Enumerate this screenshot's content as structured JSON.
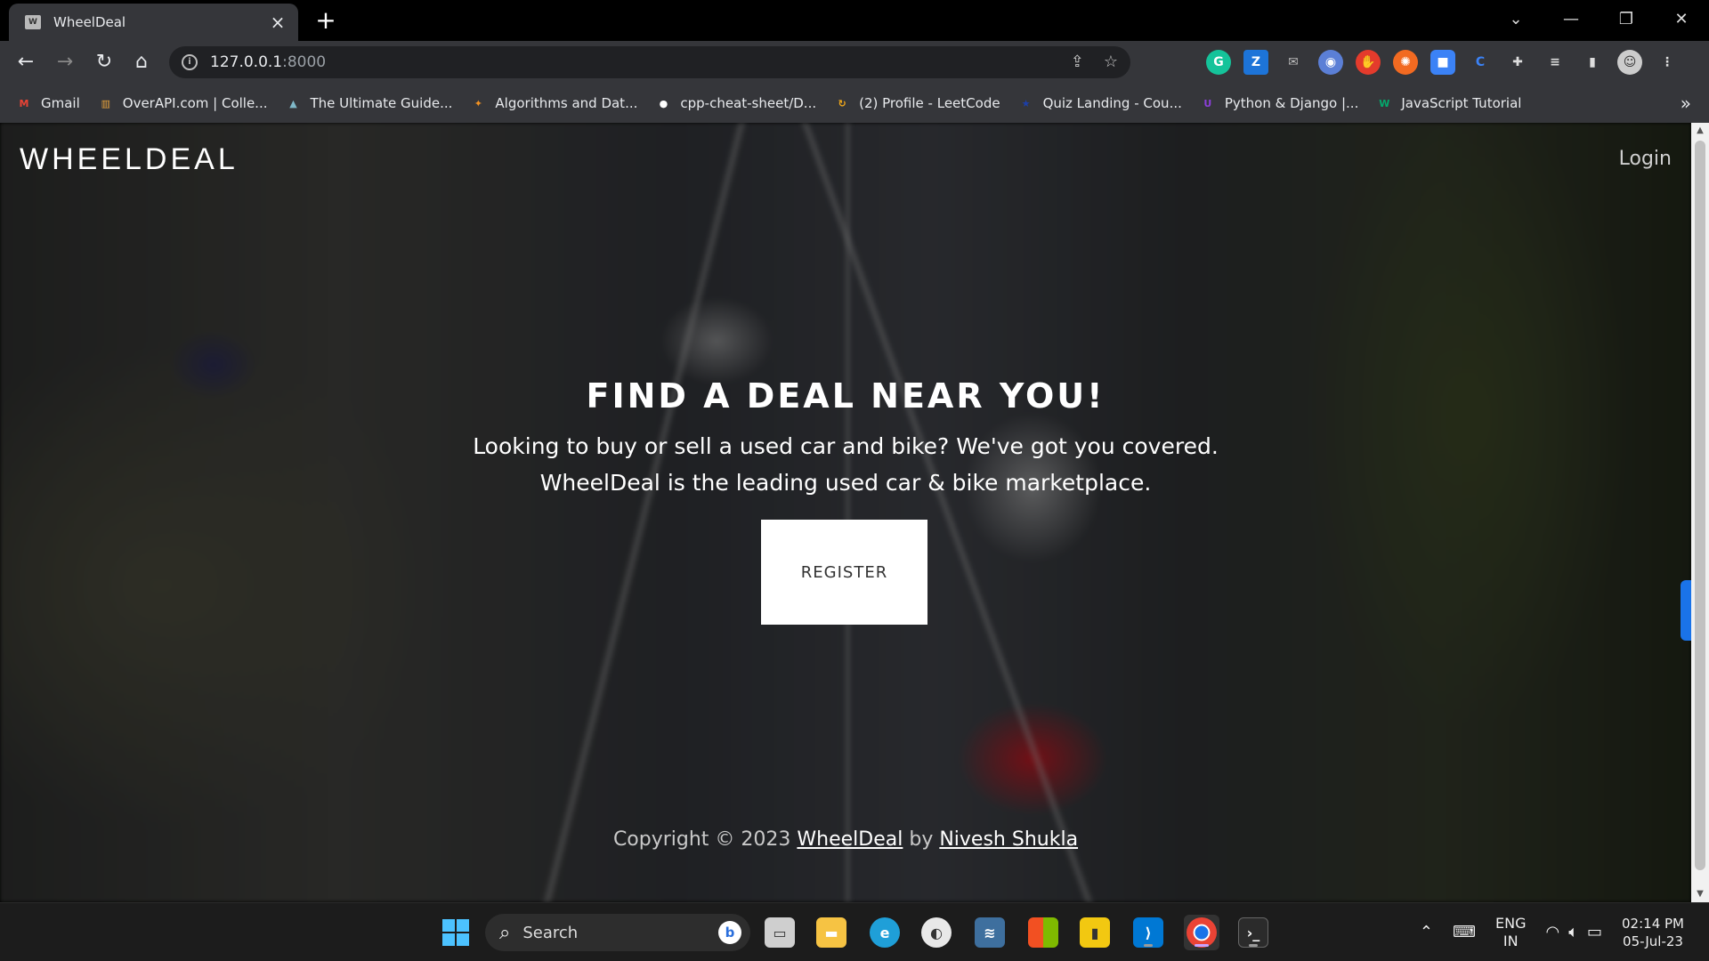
{
  "browser": {
    "tab_title": "WheelDeal",
    "url_host": "127.0.0.1",
    "url_port": ":8000",
    "bookmarks": [
      {
        "label": "Gmail",
        "color": "#ea4335",
        "glyph": "M"
      },
      {
        "label": "OverAPI.com | Colle...",
        "color": "#e8a33c",
        "glyph": "▥"
      },
      {
        "label": "The Ultimate Guide...",
        "color": "#7fb8c8",
        "glyph": "▲"
      },
      {
        "label": "Algorithms and Dat...",
        "color": "#f29222",
        "glyph": "✦"
      },
      {
        "label": "cpp-cheat-sheet/D...",
        "color": "#ffffff",
        "glyph": "●"
      },
      {
        "label": "(2) Profile - LeetCode",
        "color": "#f1a81a",
        "glyph": "↻"
      },
      {
        "label": "Quiz Landing - Cou...",
        "color": "#1c3faa",
        "glyph": "★"
      },
      {
        "label": "Python & Django |...",
        "color": "#8b3fd9",
        "glyph": "U"
      },
      {
        "label": "JavaScript Tutorial",
        "color": "#04aa6d",
        "glyph": "W"
      }
    ]
  },
  "page": {
    "brand": "WHEELDEAL",
    "login_label": "Login",
    "hero_title": "FIND A DEAL NEAR YOU!",
    "hero_line1": "Looking to buy or sell a used car and bike? We've got you covered.",
    "hero_line2": "WheelDeal is the leading used car & bike marketplace.",
    "register_label": "REGISTER",
    "footer_prefix": "Copyright © 2023 ",
    "footer_brand": "WheelDeal",
    "footer_by": " by ",
    "footer_author": "Nivesh Shukla"
  },
  "taskbar": {
    "search_label": "Search",
    "lang_top": "ENG",
    "lang_bottom": "IN",
    "time": "02:14 PM",
    "date": "05-Jul-23"
  }
}
